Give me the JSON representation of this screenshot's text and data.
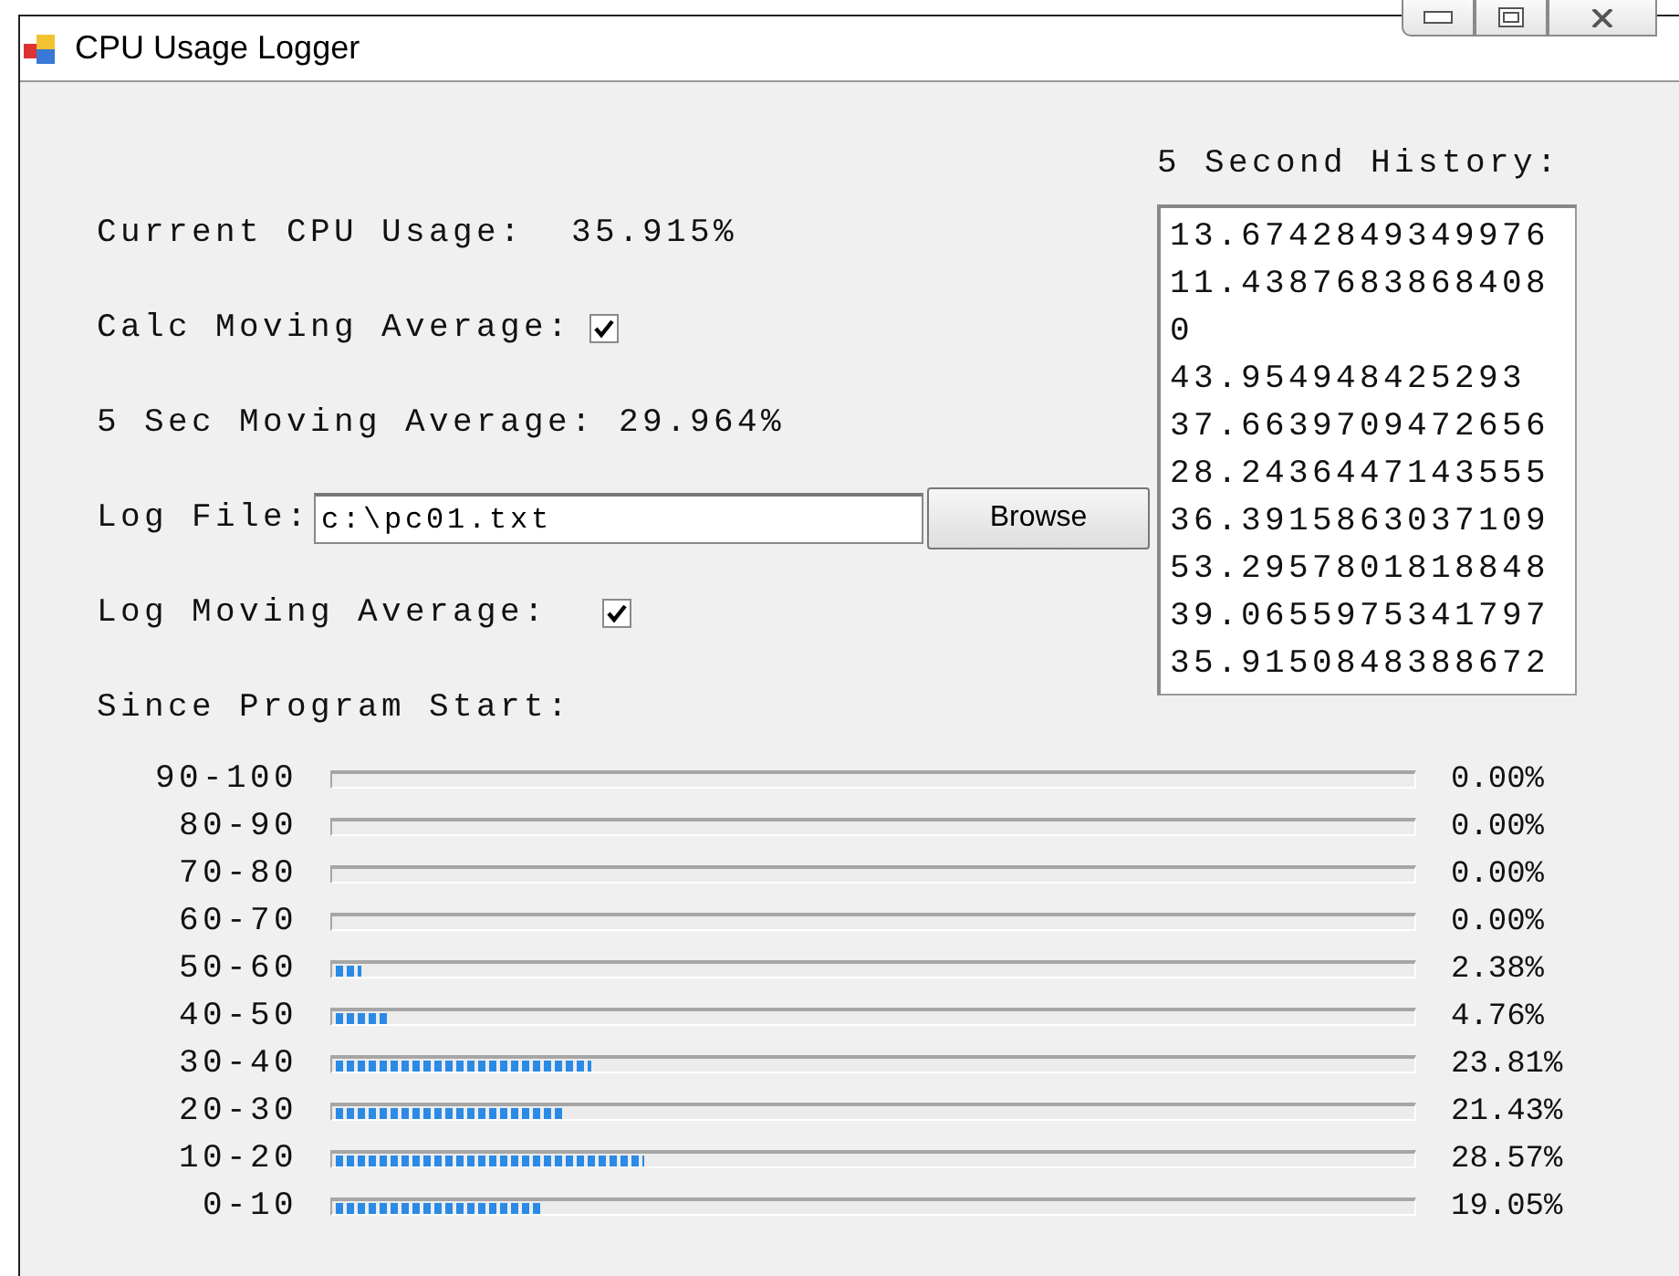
{
  "window": {
    "title": "CPU Usage Logger"
  },
  "current_usage": {
    "label": "Current CPU Usage:",
    "value": "35.915%"
  },
  "calc_moving_average": {
    "label": "Calc Moving Average:",
    "checked": true
  },
  "moving_average": {
    "label": "5 Sec Moving Average:",
    "value": "29.964%"
  },
  "log_file": {
    "label": "Log File:",
    "value": "c:\\pc01.txt",
    "button": "Browse"
  },
  "log_moving_average": {
    "label": "Log Moving Average:",
    "checked": true
  },
  "history": {
    "title": "5 Second History:",
    "values": [
      "13.6742849349976",
      "11.4387683868408",
      "0",
      "43.954948425293",
      "37.6639709472656",
      "28.2436447143555",
      "36.3915863037109",
      "53.2957801818848",
      "39.0655975341797",
      "35.9150848388672"
    ]
  },
  "histogram": {
    "title": "Since Program Start:",
    "rows": [
      {
        "range": "90-100",
        "level": 0,
        "reading": "0.00%"
      },
      {
        "range": "80-90",
        "level": 0,
        "reading": "0.00%"
      },
      {
        "range": "70-80",
        "level": 0,
        "reading": "0.00%"
      },
      {
        "range": "60-70",
        "level": 0,
        "reading": "0.00%"
      },
      {
        "range": "50-60",
        "level": 0.0238,
        "reading": "2.38%"
      },
      {
        "range": "40-50",
        "level": 0.0476,
        "reading": "4.76%"
      },
      {
        "range": "30-40",
        "level": 0.2381,
        "reading": "23.81%"
      },
      {
        "range": "20-30",
        "level": 0.2143,
        "reading": "21.43%"
      },
      {
        "range": "10-20",
        "level": 0.2857,
        "reading": "28.57%"
      },
      {
        "range": "0-10",
        "level": 0.1905,
        "reading": "19.05%"
      }
    ]
  }
}
